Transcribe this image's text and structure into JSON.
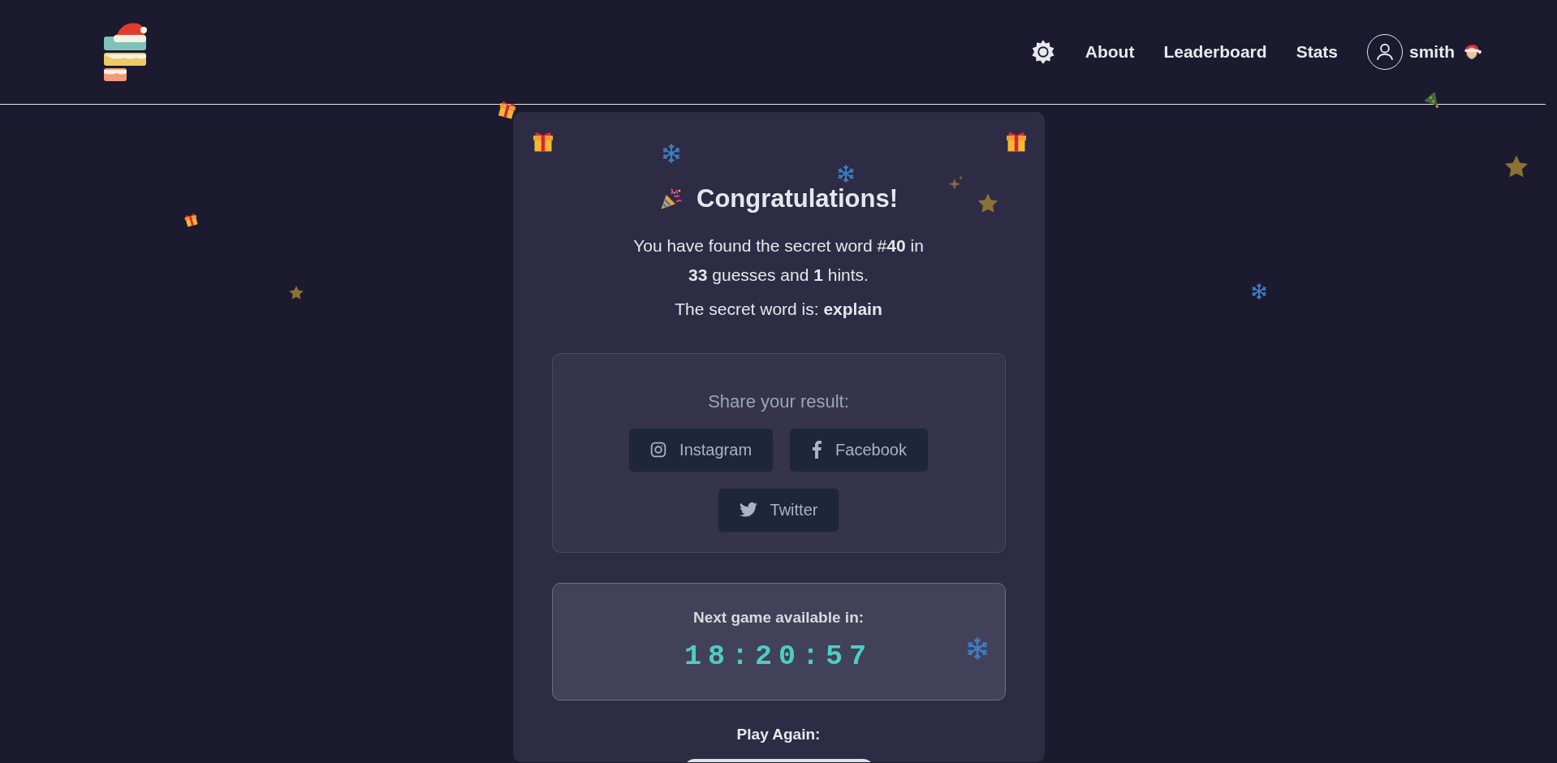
{
  "header": {
    "nav": [
      {
        "label": "About"
      },
      {
        "label": "Leaderboard"
      },
      {
        "label": "Stats"
      }
    ],
    "user": {
      "name": "smith"
    }
  },
  "result": {
    "title": "Congratulations!",
    "message": "You have found the secret word #**40** in **33** guesses and **1** hints.",
    "secret_line": "The secret word is: **explain**"
  },
  "share": {
    "label": "Share your result:",
    "buttons": [
      {
        "kind": "instagram",
        "label": "Instagram"
      },
      {
        "kind": "facebook",
        "label": "Facebook"
      },
      {
        "kind": "twitter",
        "label": "Twitter"
      }
    ]
  },
  "countdown": {
    "label": "Next game available in:",
    "time": "18:20:57"
  },
  "play_again": {
    "label": "Play Again:"
  }
}
